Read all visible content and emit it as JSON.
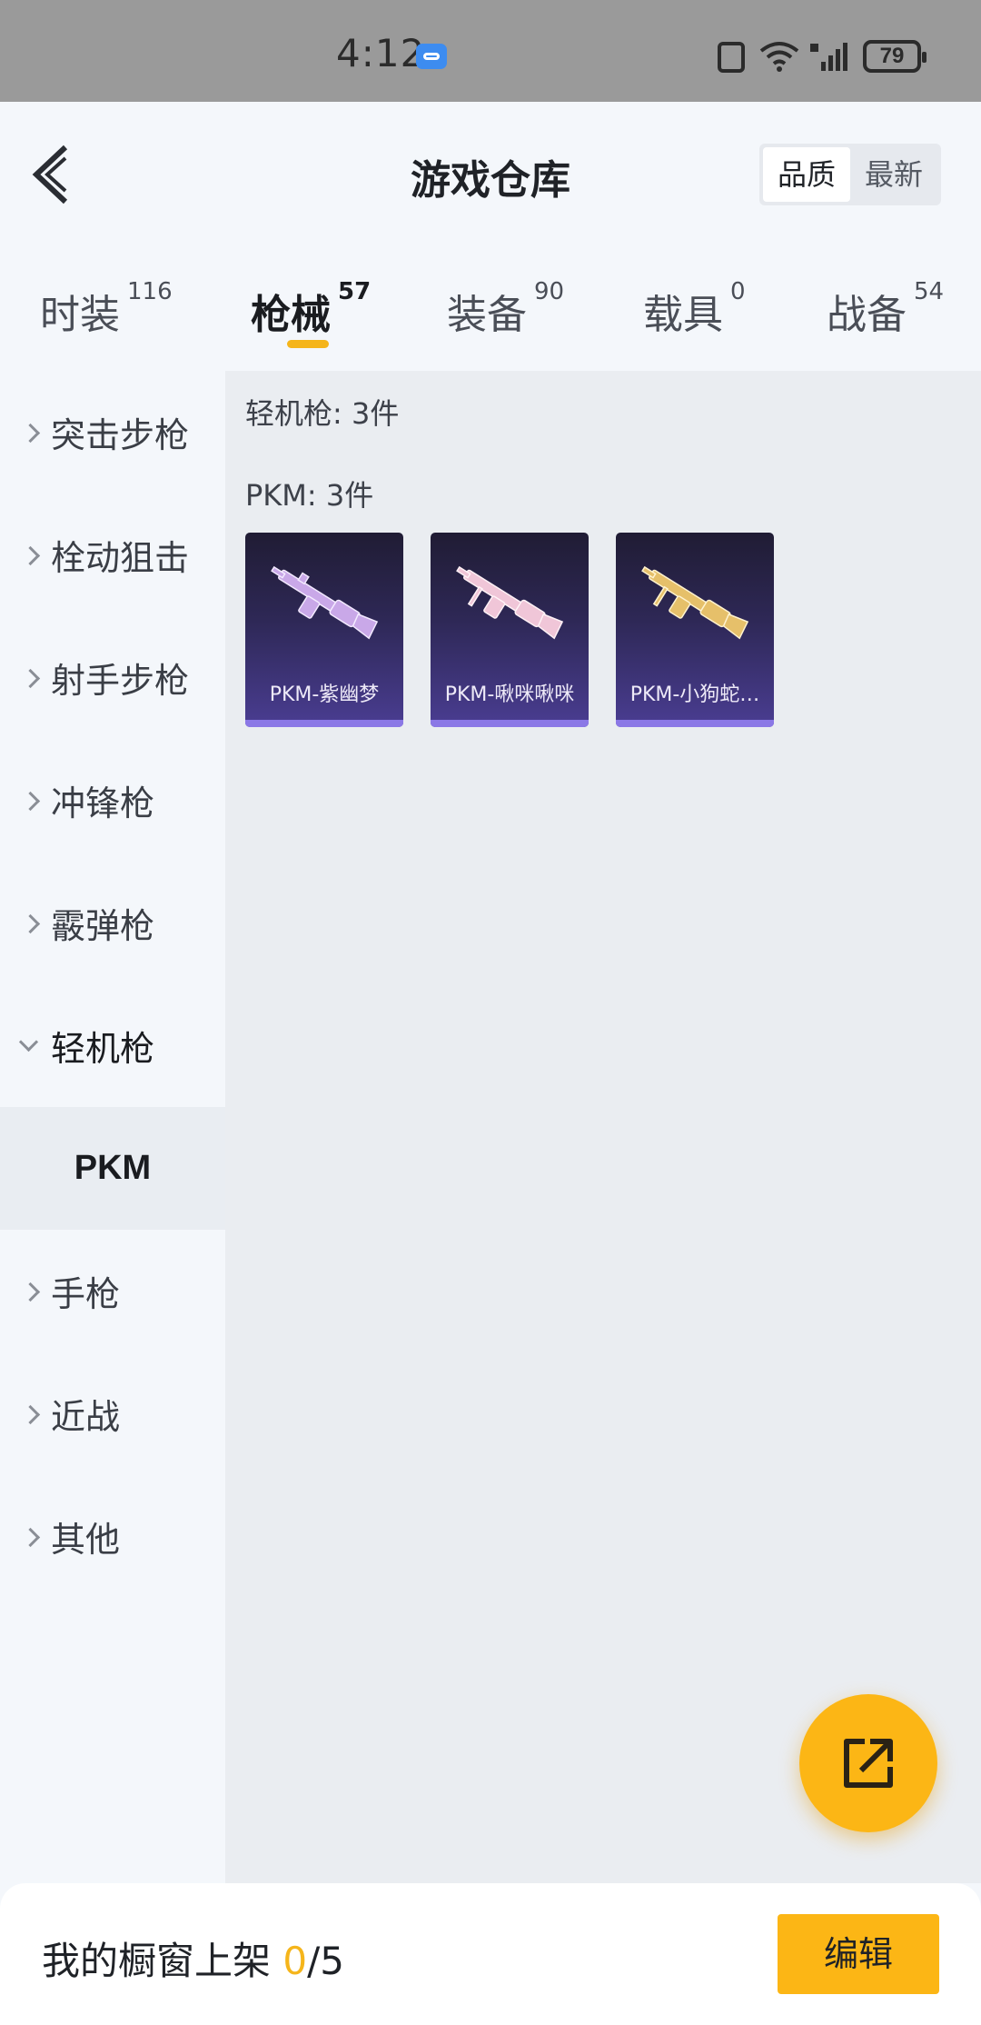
{
  "status_bar": {
    "time": "4:12",
    "battery": "79"
  },
  "header": {
    "title": "游戏仓库",
    "sort_options": [
      "品质",
      "最新"
    ],
    "sort_selected": "品质"
  },
  "tabs": [
    {
      "label": "时装",
      "count": "116"
    },
    {
      "label": "枪械",
      "count": "57",
      "active": true
    },
    {
      "label": "装备",
      "count": "90"
    },
    {
      "label": "载具",
      "count": "0"
    },
    {
      "label": "战备",
      "count": "54"
    }
  ],
  "sidebar": {
    "items": [
      {
        "label": "突击步枪"
      },
      {
        "label": "栓动狙击"
      },
      {
        "label": "射手步枪"
      },
      {
        "label": "冲锋枪"
      },
      {
        "label": "霰弹枪"
      },
      {
        "label": "轻机枪",
        "expanded": true
      },
      {
        "label": "手枪"
      },
      {
        "label": "近战"
      },
      {
        "label": "其他"
      }
    ],
    "sub_item": "PKM"
  },
  "content": {
    "category_count": "轻机枪: 3件",
    "weapon_count": "PKM: 3件",
    "items": [
      {
        "name": "PKM-紫幽梦",
        "tint": "#c9a8e8"
      },
      {
        "name": "PKM-啾咪啾咪",
        "tint": "#f0c6d8"
      },
      {
        "name": "PKM-小狗蛇…",
        "tint": "#e6c06a"
      }
    ]
  },
  "footer": {
    "label": "我的橱窗上架 ",
    "current": "0",
    "total": "/5",
    "edit_label": "编辑"
  },
  "colors": {
    "accent": "#fcb615",
    "underline": "#f5b51b"
  }
}
